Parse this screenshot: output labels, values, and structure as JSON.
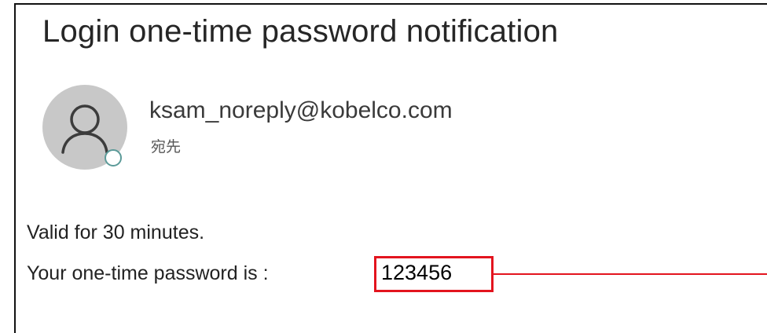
{
  "email": {
    "subject": "Login one-time password notification",
    "sender": "ksam_noreply@kobelco.com",
    "recipient_label": "宛先",
    "body_validity": "Valid for 30 minutes.",
    "body_otp_prefix": "Your one-time password is :",
    "otp_code": "123456"
  },
  "icons": {
    "avatar": "person-icon",
    "presence": "presence-status-icon"
  },
  "colors": {
    "highlight": "#e3141e",
    "avatar_bg": "#c8c8c8",
    "presence_ring": "#5b9a98"
  }
}
